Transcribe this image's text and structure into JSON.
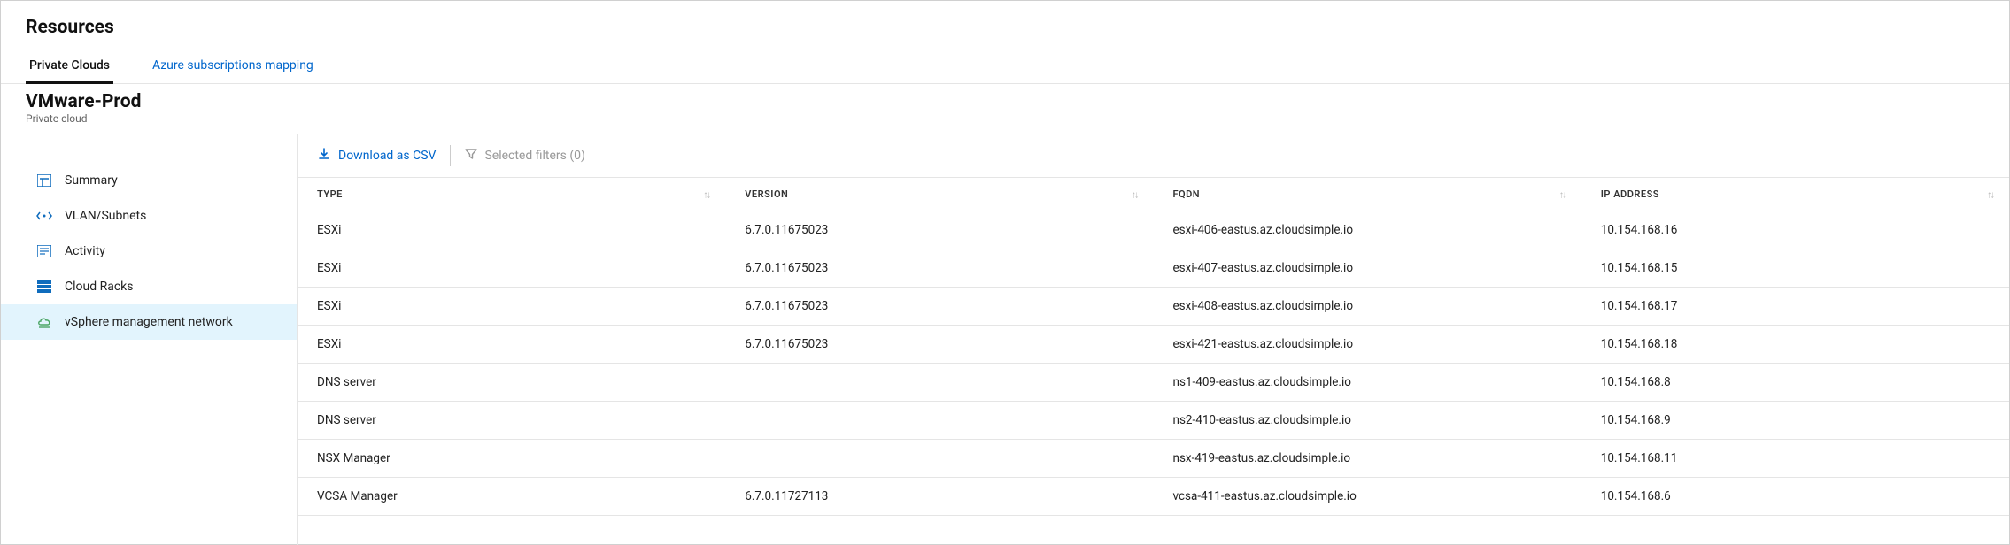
{
  "header": {
    "page_title": "Resources",
    "tabs": [
      {
        "label": "Private Clouds",
        "active": true
      },
      {
        "label": "Azure subscriptions mapping",
        "active": false
      }
    ],
    "sub_title": "VMware-Prod",
    "sub_sub": "Private cloud"
  },
  "sidebar": {
    "items": [
      {
        "label": "Summary",
        "icon": "summary"
      },
      {
        "label": "VLAN/Subnets",
        "icon": "vlan"
      },
      {
        "label": "Activity",
        "icon": "activity"
      },
      {
        "label": "Cloud Racks",
        "icon": "racks"
      },
      {
        "label": "vSphere management network",
        "icon": "vsphere",
        "active": true
      }
    ]
  },
  "toolbar": {
    "download_label": "Download as CSV",
    "filter_label": "Selected filters (0)"
  },
  "table": {
    "columns": [
      "TYPE",
      "VERSION",
      "FQDN",
      "IP ADDRESS"
    ],
    "rows": [
      {
        "type": "ESXi",
        "version": "6.7.0.11675023",
        "fqdn": "esxi-406-eastus.az.cloudsimple.io",
        "ip": "10.154.168.16"
      },
      {
        "type": "ESXi",
        "version": "6.7.0.11675023",
        "fqdn": "esxi-407-eastus.az.cloudsimple.io",
        "ip": "10.154.168.15"
      },
      {
        "type": "ESXi",
        "version": "6.7.0.11675023",
        "fqdn": "esxi-408-eastus.az.cloudsimple.io",
        "ip": "10.154.168.17"
      },
      {
        "type": "ESXi",
        "version": "6.7.0.11675023",
        "fqdn": "esxi-421-eastus.az.cloudsimple.io",
        "ip": "10.154.168.18"
      },
      {
        "type": "DNS server",
        "version": "",
        "fqdn": "ns1-409-eastus.az.cloudsimple.io",
        "ip": "10.154.168.8"
      },
      {
        "type": "DNS server",
        "version": "",
        "fqdn": "ns2-410-eastus.az.cloudsimple.io",
        "ip": "10.154.168.9"
      },
      {
        "type": "NSX Manager",
        "version": "",
        "fqdn": "nsx-419-eastus.az.cloudsimple.io",
        "ip": "10.154.168.11"
      },
      {
        "type": "VCSA Manager",
        "version": "6.7.0.11727113",
        "fqdn": "vcsa-411-eastus.az.cloudsimple.io",
        "ip": "10.154.168.6"
      }
    ]
  }
}
